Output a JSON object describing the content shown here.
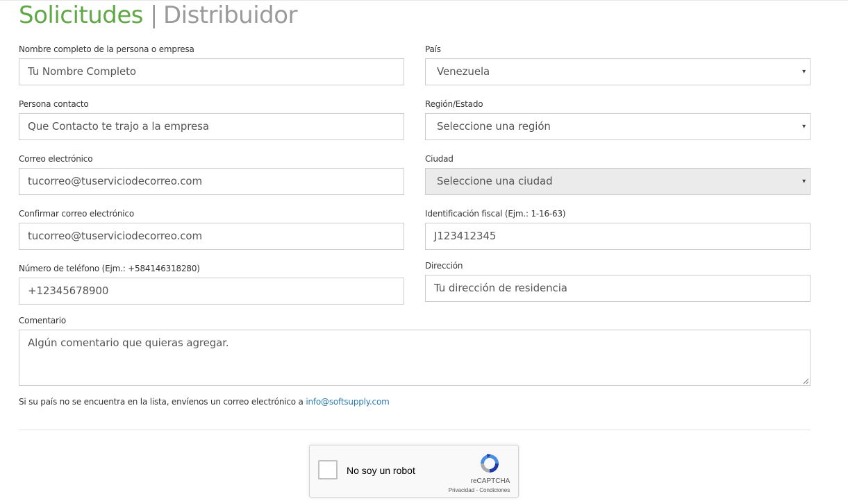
{
  "header": {
    "title_primary": "Solicitudes",
    "separator": "|",
    "title_secondary": "Distribuidor"
  },
  "left_fields": [
    {
      "label": "Nombre completo de la persona o empresa",
      "placeholder": "Tu Nombre Completo"
    },
    {
      "label": "Persona contacto",
      "placeholder": "Que Contacto te trajo a la empresa"
    },
    {
      "label": "Correo electrónico",
      "placeholder": "tucorreo@tuserviciodecorreo.com"
    },
    {
      "label": "Confirmar correo electrónico",
      "placeholder": "tucorreo@tuserviciodecorreo.com"
    },
    {
      "label": "Número de teléfono (Ejm.: +584146318280)",
      "placeholder": "+12345678900"
    }
  ],
  "right_fields": [
    {
      "label": "País",
      "value": "Venezuela"
    },
    {
      "label": "Región/Estado",
      "value": "Seleccione una región"
    },
    {
      "label": "Ciudad",
      "value": "Seleccione una ciudad"
    },
    {
      "label": "Identificación fiscal (Ejm.: 1-16-63)",
      "placeholder": "J123412345"
    },
    {
      "label": "Dirección",
      "placeholder": "Tu dirección de residencia"
    }
  ],
  "comment": {
    "label": "Comentario",
    "placeholder": "Algún comentario que quieras agregar."
  },
  "note": {
    "text": "Si su país no se encuentra en la lista, envíenos un correo electrónico a ",
    "email": "info@softsupply.com"
  },
  "captcha": {
    "label": "No soy un robot",
    "brand": "reCAPTCHA",
    "privacy": "Privacidad",
    "dash": " - ",
    "terms": "Condiciones"
  },
  "icons": {
    "select_caret": "▾"
  },
  "colors": {
    "title_green": "#5fa845",
    "title_gray": "#9a9a9a",
    "link": "#2a7ab0",
    "disabled_bg": "#ebebeb"
  }
}
